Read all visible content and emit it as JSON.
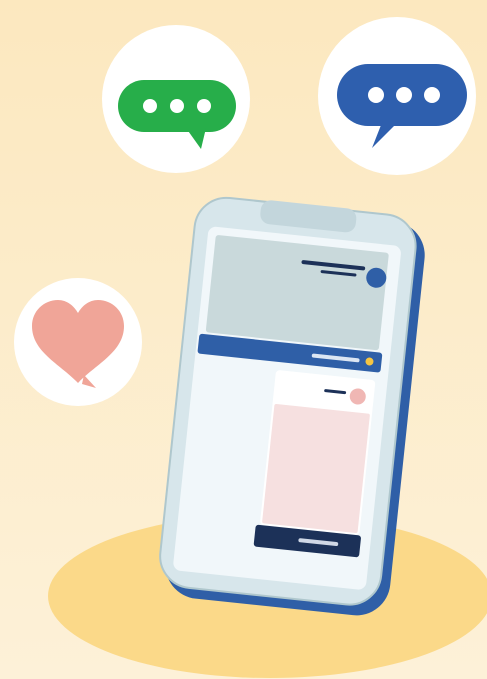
{
  "illustration": {
    "icons": [
      "green-chat-bubble-icon",
      "blue-chat-bubble-icon",
      "heart-icon",
      "smartphone-icon"
    ]
  },
  "colors": {
    "background_top": "#FCE8BF",
    "background_bottom": "#FDF1D8",
    "floor": "#FBD989",
    "green_bubble": "#27AE4A",
    "blue_bubble": "#2E5FAE",
    "heart": "#F0A598",
    "phone_body": "#2F5FA7",
    "phone_bezel": "#D7E6EB",
    "phone_screen": "#F1F7FA",
    "screen_header": "#C9D9DB",
    "screen_bar": "#2F5FA7",
    "pink_card": "#F6E0E0",
    "dark_bar": "#1C3158"
  }
}
